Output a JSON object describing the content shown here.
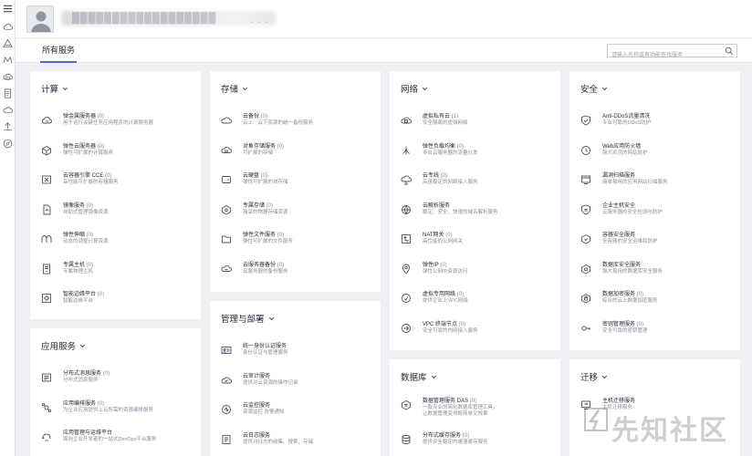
{
  "topbar": {
    "user_name": "██████████████████",
    "dots": "· · ·"
  },
  "tabs": {
    "all_services": "所有服务"
  },
  "search": {
    "placeholder": "请输入名称或者功能查找服务"
  },
  "leftnav": {
    "icons": [
      "menu-icon",
      "cloud-icon",
      "triangle-icon",
      "network-icon",
      "cloud-store-icon",
      "document-icon",
      "cloud-outline-icon",
      "upload-icon",
      "compass-icon"
    ]
  },
  "categories": {
    "compute": {
      "title": "计算",
      "items": [
        {
          "name": "弹金属服务器",
          "count": " (0)",
          "desc": "用于运行关键任务应用程序的计算服务器",
          "icon": "server-cloud-icon"
        },
        {
          "name": "弹性云服务器",
          "count": " (0)",
          "desc": "弹性可扩展的计算服务",
          "icon": "cube-icon"
        },
        {
          "name": "云容器引擎 CCE",
          "count": " (0)",
          "desc": "高性能可扩展的容器服务",
          "icon": "container-icon"
        },
        {
          "name": "镜像服务",
          "count": " (0)",
          "desc": "自助式管理镜像资源",
          "icon": "image-file-icon"
        },
        {
          "name": "弹性伸缩",
          "count": " (0)",
          "desc": "动态的调整计算资源",
          "icon": "autoscale-icon"
        },
        {
          "name": "专属主机",
          "count": " (0)",
          "desc": "专属物理主机",
          "icon": "host-icon"
        },
        {
          "name": "智能边缘平台",
          "count": " (0)",
          "desc": "智能边缘平台",
          "icon": "edge-icon"
        }
      ]
    },
    "app_services": {
      "title": "应用服务",
      "items": [
        {
          "name": "分布式消息服务",
          "count": " (0)",
          "desc": "分布式消息服务",
          "icon": "message-icon"
        },
        {
          "name": "应用编排服务",
          "count": " (0)",
          "desc": "为企业应用提供上云所需的资源编排服务",
          "icon": "orchestration-icon"
        },
        {
          "name": "应用管理与运维平台",
          "count": "",
          "desc": "面向企业开发者的一站式DevOps平台服务",
          "icon": "devops-icon"
        }
      ]
    },
    "storage": {
      "title": "存储",
      "items": [
        {
          "name": "云备份",
          "count": " (0)",
          "desc": "云上、云下资源的统一备份服务",
          "icon": "cloud-backup-icon"
        },
        {
          "name": "对象存储服务",
          "count": " (0)",
          "desc": "可扩展的存储",
          "icon": "object-storage-icon"
        },
        {
          "name": "云硬盘",
          "count": " (0)",
          "desc": "弹性可扩展的块存储",
          "icon": "disk-icon"
        },
        {
          "name": "专属存储",
          "count": " (0)",
          "desc": "独享的物理存储资源",
          "icon": "dedicated-storage-icon"
        },
        {
          "name": "弹性文件服务",
          "count": " (0)",
          "desc": "弹性可扩展的文件服务",
          "icon": "folder-icon"
        },
        {
          "name": "云服务器备份",
          "count": " (0)",
          "desc": "云服务器的备份服务",
          "icon": "server-backup-icon"
        }
      ]
    },
    "management": {
      "title": "管理与部署",
      "items": [
        {
          "name": "统一身份认证服务",
          "count": "",
          "desc": "身份认证与管理服务",
          "icon": "id-card-icon"
        },
        {
          "name": "云审计服务",
          "count": "",
          "desc": "提供对云资源的操作记录",
          "icon": "audit-icon"
        },
        {
          "name": "云监控服务",
          "count": "",
          "desc": "资源监控 告警通知",
          "icon": "monitor-icon"
        },
        {
          "name": "云日志服务",
          "count": "",
          "desc": "提供对日志的收集、搜索、存储",
          "icon": "log-icon"
        }
      ]
    },
    "network": {
      "title": "网络",
      "items": [
        {
          "name": "虚拟私有云",
          "count": " (1)",
          "desc": "安全隔离的虚拟网络",
          "icon": "vpc-icon"
        },
        {
          "name": "弹性负载均衡",
          "count": " (0)",
          "desc": "多台云服务器的流量分发",
          "icon": "load-balancer-icon"
        },
        {
          "name": "云专线",
          "count": " (0)",
          "desc": "高速稳定的网络接入服务",
          "icon": "direct-connect-icon"
        },
        {
          "name": "云解析服务",
          "count": "",
          "desc": "稳定、安全、快速的域名解析服务",
          "icon": "dns-icon"
        },
        {
          "name": "NAT网关",
          "count": " (0)",
          "desc": "高性能的公网网关",
          "icon": "nat-icon"
        },
        {
          "name": "弹性IP",
          "count": " (0)",
          "desc": "弹性公网IP资源访问",
          "icon": "eip-icon"
        },
        {
          "name": "虚拟专用网络",
          "count": " (0)",
          "desc": "提供企业上VPC网络",
          "icon": "vpn-icon"
        },
        {
          "name": "VPC 终端节点",
          "count": " (0)",
          "desc": "安全可靠的内网接入服务",
          "icon": "endpoint-icon"
        }
      ]
    },
    "database": {
      "title": "数据库",
      "items": [
        {
          "name": "数据管理服务 DAS",
          "count": " (0)",
          "desc": "一款专业的简化数据库管理工具，",
          "desc2": "让数据管理变得既简单又效果",
          "icon": "das-icon"
        },
        {
          "name": "分布式缓存服务",
          "count": " (0)",
          "desc": "提供安全稳定的缓速缓存服务",
          "icon": "cache-icon"
        }
      ]
    },
    "security": {
      "title": "安全",
      "items": [
        {
          "name": "Anti-DDoS流量清洗",
          "count": "",
          "desc": "专业可靠的DDoS防护",
          "icon": "anti-ddos-icon"
        },
        {
          "name": "Web应用防火墙",
          "count": "",
          "desc": "强大灵活的网站防护",
          "icon": "waf-icon"
        },
        {
          "name": "漏洞扫描服务",
          "count": "",
          "desc": "简单易用的应用网站扫描服务",
          "icon": "vuln-scan-icon"
        },
        {
          "name": "企业主机安全",
          "count": "",
          "desc": "云服务器的安全检测与防护",
          "icon": "host-security-icon"
        },
        {
          "name": "容器安全服务",
          "count": "",
          "desc": "全容器的安全运维和防护",
          "icon": "container-security-icon"
        },
        {
          "name": "数据库安全服务",
          "count": "",
          "desc": "强大易用的数据库安全服务",
          "icon": "db-security-icon"
        },
        {
          "name": "数据加密服务",
          "count": " (0)",
          "desc": "综合的云上数据加密服务",
          "icon": "encryption-icon"
        },
        {
          "name": "密钥管理服务",
          "count": " (0)",
          "desc": "安全可靠的密钥管理",
          "icon": "key-icon"
        }
      ]
    },
    "migration": {
      "title": "迁移",
      "items": [
        {
          "name": "主机迁移服务",
          "count": "",
          "desc": "主机迁移服务",
          "icon": "migration-icon"
        }
      ]
    }
  },
  "watermark": {
    "text": "先知社区"
  }
}
